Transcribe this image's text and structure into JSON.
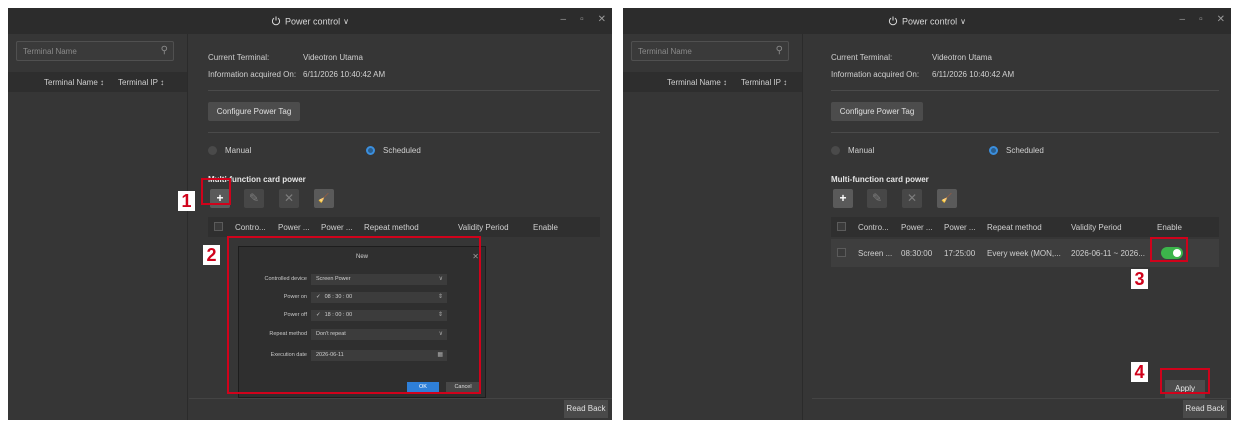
{
  "window": {
    "title": "Power control"
  },
  "sidebar": {
    "search_placeholder": "Terminal Name",
    "col_name": "Terminal Name ↕",
    "col_ip": "Terminal IP ↕"
  },
  "info": {
    "current_terminal_label": "Current Terminal:",
    "current_terminal_value": "Videotron Utama",
    "acquired_label": "Information acquired On:",
    "acquired_value": "6/11/2026 10:40:42 AM"
  },
  "buttons": {
    "configure": "Configure Power Tag",
    "read_back": "Read Back",
    "apply": "Apply",
    "ok": "OK",
    "cancel": "Cancel"
  },
  "mode": {
    "manual": "Manual",
    "scheduled": "Scheduled",
    "selected": "Scheduled"
  },
  "section": {
    "title": "Multi-function card power"
  },
  "table": {
    "headers": [
      "Contro...",
      "Power ...",
      "Power ...",
      "Repeat method",
      "Validity Period",
      "Enable"
    ],
    "rows": [
      {
        "device": "Screen ...",
        "on": "08:30:00",
        "off": "17:25:00",
        "repeat": "Every week  (MON,...",
        "validity": "2026-06-11 ~ 2026...",
        "enabled": true
      }
    ]
  },
  "dialog": {
    "title": "New",
    "controlled_label": "Controlled device",
    "controlled_value": "Screen Power",
    "power_on_label": "Power on",
    "power_on_value": "08 : 30 : 00",
    "power_off_label": "Power off",
    "power_off_value": "18 : 00 : 00",
    "repeat_label": "Repeat method",
    "repeat_value": "Don't repeat",
    "exec_label": "Execution date",
    "exec_value": "2026-06-11"
  },
  "annotations": [
    "1",
    "2",
    "3",
    "4"
  ]
}
